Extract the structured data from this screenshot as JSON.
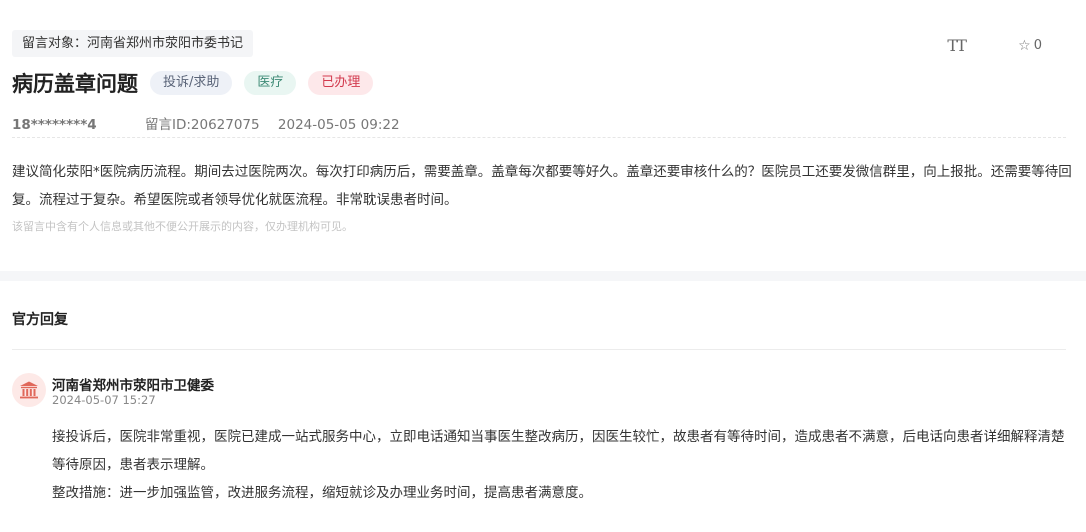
{
  "header": {
    "target_label": "留言对象：河南省郑州市荥阳市委书记",
    "title": "病历盖章问题",
    "badges": {
      "type": "投诉/求助",
      "field": "医疗",
      "status": "已办理"
    },
    "tools": {
      "font_size_glyph": "TT",
      "favorite_count": "0"
    },
    "icons": {
      "font_size": "font-size-icon",
      "star": "star-outline-icon"
    }
  },
  "meta": {
    "user": "18********4",
    "message_id": "留言ID:20627075",
    "datetime": "2024-05-05 09:22"
  },
  "message": {
    "content": "建议简化荥阳*医院病历流程。期间去过医院两次。每次打印病历后，需要盖章。盖章每次都要等好久。盖章还要审核什么的？医院员工还要发微信群里，向上报批。还需要等待回复。流程过于复杂。希望医院或者领导优化就医流程。非常耽误患者时间。",
    "privacy_note": "该留言中含有个人信息或其他不便公开展示的内容，仅办理机构可见。"
  },
  "reply": {
    "section_title": "官方回复",
    "org_name": "河南省郑州市荥阳市卫健委",
    "time": "2024-05-07 15:27",
    "paragraph_1": "接投诉后，医院非常重视，医院已建成一站式服务中心，立即电话通知当事医生整改病历，因医生较忙，故患者有等待时间，造成患者不满意，后电话向患者详细解释清楚等待原因，患者表示理解。",
    "paragraph_2": "整改措施：进一步加强监管，改进服务流程，缩短就诊及办理业务时间，提高患者满意度。",
    "icons": {
      "org": "government-building-icon"
    }
  },
  "colors": {
    "status_red": "#d23a4e",
    "field_green": "#3d8a75",
    "avatar_bg": "#fde9e7",
    "avatar_icon": "#e0685a"
  }
}
